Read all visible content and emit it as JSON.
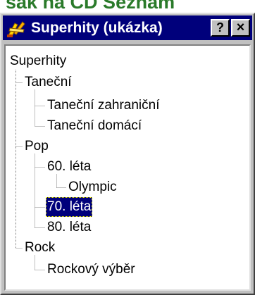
{
  "background": {
    "partial_text": "sak na CD Seznam"
  },
  "window": {
    "title": "Superhity (ukázka)",
    "help_button": "?",
    "close_button": "×",
    "title_bar_color": "#00007b",
    "selection_color": "#00007b"
  },
  "tree": {
    "root": "Superhity",
    "nodes": [
      {
        "label": "Taneční",
        "children": [
          {
            "label": "Taneční zahraniční"
          },
          {
            "label": "Taneční domácí"
          }
        ]
      },
      {
        "label": "Pop",
        "children": [
          {
            "label": "60. léta",
            "children": [
              {
                "label": "Olympic"
              }
            ]
          },
          {
            "label": "70. léta",
            "selected": true
          },
          {
            "label": "80. léta"
          }
        ]
      },
      {
        "label": "Rock",
        "children": [
          {
            "label": "Rockový výběr"
          }
        ]
      }
    ]
  }
}
